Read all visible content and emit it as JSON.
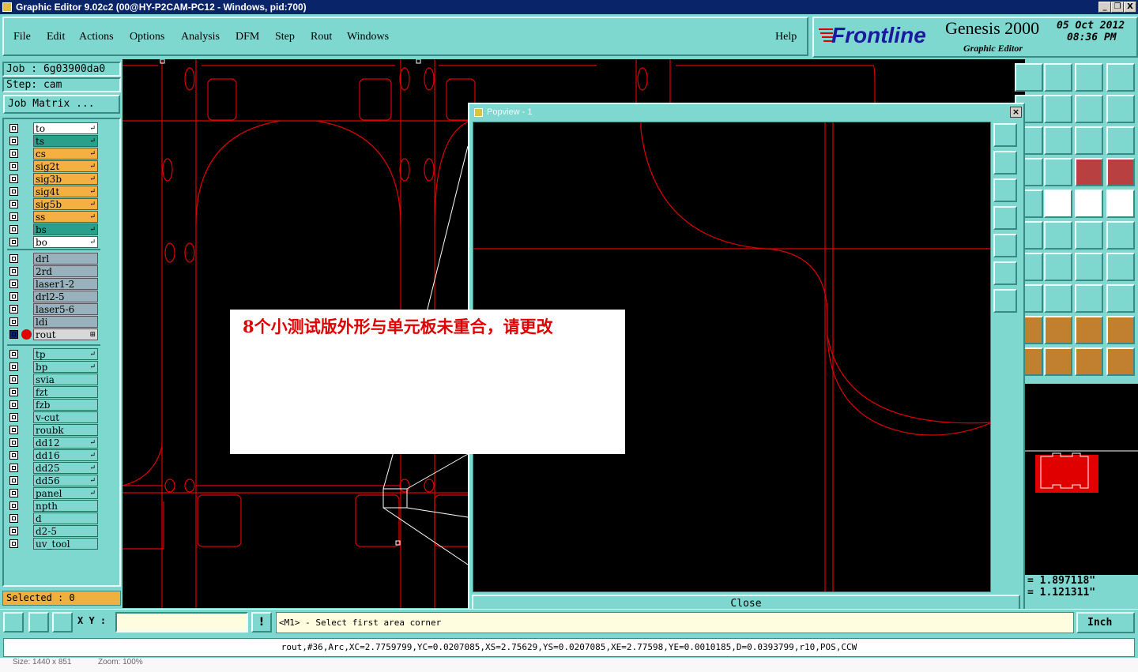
{
  "window": {
    "title": "Graphic Editor 9.02c2 (00@HY-P2CAM-PC12 - Windows, pid:700)",
    "min": "_",
    "max": "❐",
    "close": "X"
  },
  "menu": {
    "items": [
      "File",
      "Edit",
      "Actions",
      "Options",
      "Analysis",
      "DFM",
      "Step",
      "Rout",
      "Windows"
    ],
    "help": "Help"
  },
  "logo": {
    "brand": "Frontline",
    "product": "Genesis 2000",
    "subtitle": "Graphic Editor",
    "date": "05 Oct 2012",
    "time": "08:36 PM"
  },
  "job": {
    "job_label": "Job : 6g03900da0",
    "step_label": "Step: cam",
    "matrix_button": "Job Matrix ..."
  },
  "layers": {
    "group1": [
      {
        "name": "to",
        "color": "#ffffff",
        "icon": "↵"
      },
      {
        "name": "ts",
        "color": "#2aa08a",
        "icon": "↵"
      },
      {
        "name": "cs",
        "color": "#f4b040",
        "icon": "↵"
      },
      {
        "name": "sig2t",
        "color": "#f4b040",
        "icon": "↵"
      },
      {
        "name": "sig3b",
        "color": "#f4b040",
        "icon": "↵"
      },
      {
        "name": "sig4t",
        "color": "#f4b040",
        "icon": "↵"
      },
      {
        "name": "sig5b",
        "color": "#f4b040",
        "icon": "↵"
      },
      {
        "name": "ss",
        "color": "#f4b040",
        "icon": "↵"
      },
      {
        "name": "bs",
        "color": "#2aa08a",
        "icon": "↵"
      },
      {
        "name": "bo",
        "color": "#ffffff",
        "icon": "↵"
      }
    ],
    "group2": [
      {
        "name": "drl",
        "color": "#9ab0bc",
        "icon": ""
      },
      {
        "name": "2rd",
        "color": "#9ab0bc",
        "icon": ""
      },
      {
        "name": "laser1-2",
        "color": "#9ab0bc",
        "icon": ""
      },
      {
        "name": "drl2-5",
        "color": "#9ab0bc",
        "icon": ""
      },
      {
        "name": "laser5-6",
        "color": "#9ab0bc",
        "icon": ""
      },
      {
        "name": "ldi",
        "color": "#9ab0bc",
        "icon": ""
      },
      {
        "name": "rout",
        "color": "#d8d8d8",
        "icon": "⊞"
      }
    ],
    "group3": [
      {
        "name": "tp",
        "color": "#7fd8d0",
        "icon": "↵"
      },
      {
        "name": "bp",
        "color": "#7fd8d0",
        "icon": "↵"
      },
      {
        "name": "svia",
        "color": "#7fd8d0",
        "icon": ""
      },
      {
        "name": "fzt",
        "color": "#7fd8d0",
        "icon": ""
      },
      {
        "name": "fzb",
        "color": "#7fd8d0",
        "icon": ""
      },
      {
        "name": "v-cut",
        "color": "#7fd8d0",
        "icon": ""
      },
      {
        "name": "roubk",
        "color": "#7fd8d0",
        "icon": ""
      },
      {
        "name": "dd12",
        "color": "#7fd8d0",
        "icon": "↵"
      },
      {
        "name": "dd16",
        "color": "#7fd8d0",
        "icon": "↵"
      },
      {
        "name": "dd25",
        "color": "#7fd8d0",
        "icon": "↵"
      },
      {
        "name": "dd56",
        "color": "#7fd8d0",
        "icon": "↵"
      },
      {
        "name": "panel",
        "color": "#7fd8d0",
        "icon": "↵"
      },
      {
        "name": "npth",
        "color": "#7fd8d0",
        "icon": ""
      },
      {
        "name": "d",
        "color": "#7fd8d0",
        "icon": ""
      },
      {
        "name": "d2-5",
        "color": "#7fd8d0",
        "icon": ""
      },
      {
        "name": "uv_tool",
        "color": "#7fd8d0",
        "icon": ""
      }
    ]
  },
  "selected": "Selected : 0",
  "popview": {
    "title": "Popview - 1",
    "close_button": "Close"
  },
  "message": "8个小测试版外形与单元板未重合，请更改",
  "coords": {
    "x": "= 1.897118\"",
    "y": "= 1.121311\""
  },
  "bottom": {
    "xy_label": "X Y :",
    "xy_value": "",
    "prompt": "<M1> - Select first area corner",
    "unit": "Inch",
    "warn": "!"
  },
  "status": "rout,#36,Arc,XC=2.7759799,YC=0.0207085,XS=2.75629,YS=0.0207085,XE=2.77598,YE=0.0010185,D=0.0393799,r10,POS,CCW",
  "footer": {
    "size": "Size: 1440 x 851",
    "zoom": "Zoom: 100%"
  },
  "colors": {
    "route": "#e00000",
    "accent": "#7fd8d0",
    "title": "#0a246a"
  }
}
